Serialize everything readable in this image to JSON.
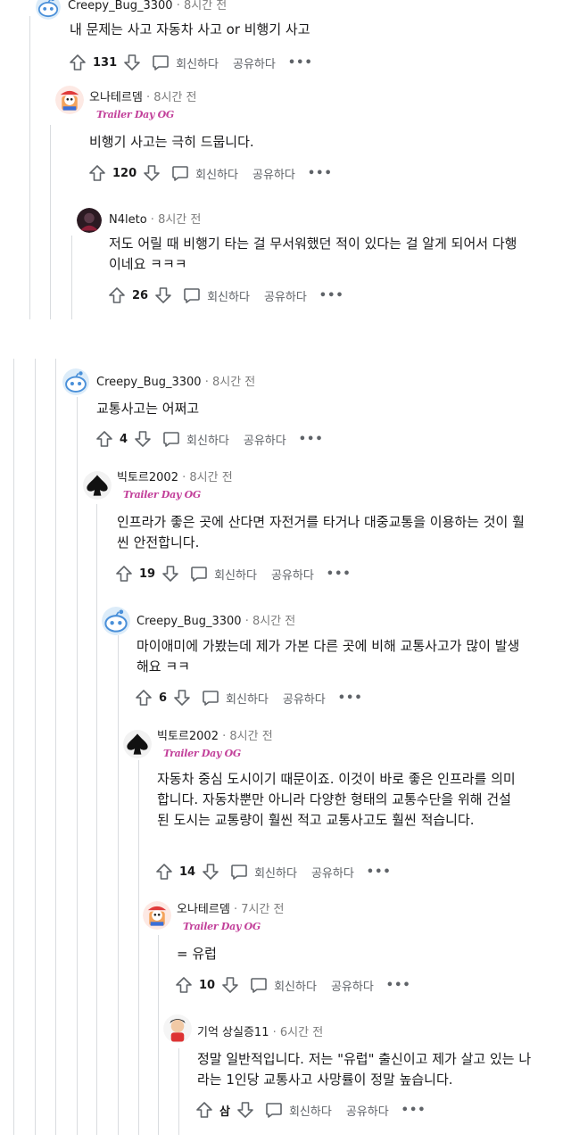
{
  "actions": {
    "reply_label": "회신하다",
    "share_label": "공유하다",
    "more_label": "•••"
  },
  "comments": [
    {
      "user": "Creepy_Bug_3300",
      "time": "8시간 전",
      "flair": "",
      "text": "내 문제는 사고 자동차 사고 or 비행기 사고",
      "score": "131",
      "avatar": "reddit-snoo-avatar"
    },
    {
      "user": "오나테르뎀",
      "time": "8시간 전",
      "flair": "Trailer Day OG",
      "text": "비행기 사고는 극히 드뭅니다.",
      "score": "120",
      "avatar": "cartoon-avatar"
    },
    {
      "user": "N4leto",
      "time": "8시간 전",
      "flair": "",
      "text": "저도 어릴 때 비행기 타는 걸 무서워했던 적이 있다는 걸 알게 되어서 다행이네요 ㅋㅋㅋ",
      "score": "26",
      "avatar": "dark-avatar"
    },
    {
      "user": "Creepy_Bug_3300",
      "time": "8시간 전",
      "flair": "",
      "text": "교통사고는 어쩌고",
      "score": "4",
      "avatar": "reddit-snoo-avatar"
    },
    {
      "user": "빅토르2002",
      "time": "8시간 전",
      "flair": "Trailer Day OG",
      "text": "인프라가 좋은 곳에 산다면 자전거를 타거나 대중교통을 이용하는 것이 훨씬 안전합니다.",
      "score": "19",
      "avatar": "spade-avatar"
    },
    {
      "user": "Creepy_Bug_3300",
      "time": "8시간 전",
      "flair": "",
      "text": "마이애미에 가봤는데 제가 가본 다른 곳에 비해 교통사고가 많이 발생해요 ㅋㅋ",
      "score": "6",
      "avatar": "reddit-snoo-avatar"
    },
    {
      "user": "빅토르2002",
      "time": "8시간 전",
      "flair": "Trailer Day OG",
      "text": "자동차 중심 도시이기 때문이죠. 이것이 바로 좋은 인프라를 의미합니다. 자동차뿐만 아니라 다양한 형태의 교통수단을 위해 건설된 도시는 교통량이 훨씬 적고 교통사고도 훨씬 적습니다.",
      "score": "14",
      "avatar": "spade-avatar"
    },
    {
      "user": "오나테르뎀",
      "time": "7시간 전",
      "flair": "Trailer Day OG",
      "text": "= 유럽",
      "score": "10",
      "avatar": "cartoon-avatar"
    },
    {
      "user": "기억 상실증11",
      "time": "6시간 전",
      "flair": "",
      "text": "정말 일반적입니다. 저는 \"유럽\" 출신이고 제가 살고 있는 나라는 1인당 교통사고 사망률이 정말 높습니다.",
      "score": "삼",
      "avatar": "character-avatar"
    }
  ]
}
